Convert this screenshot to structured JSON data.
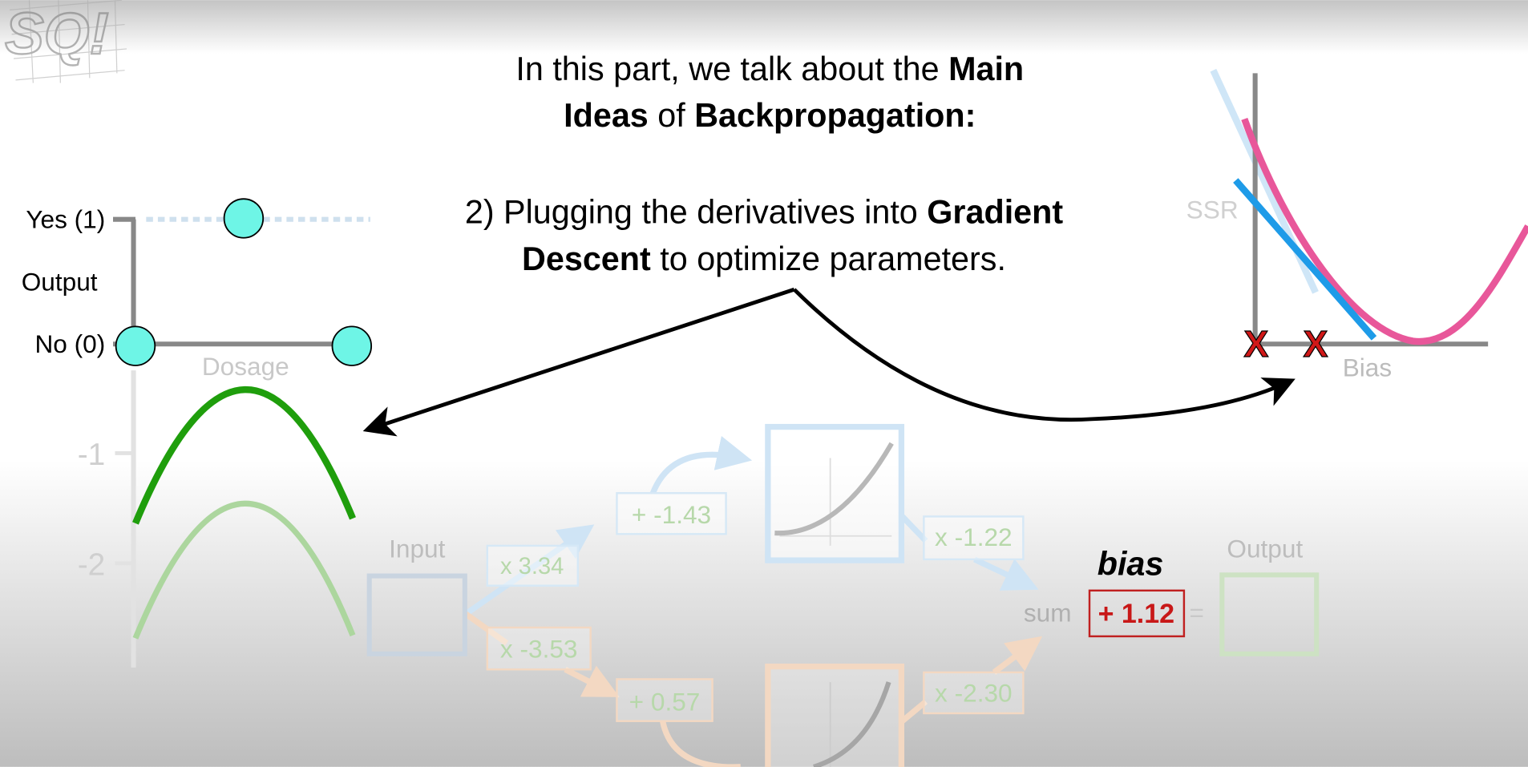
{
  "logo": {
    "text": "SQ!"
  },
  "heading": {
    "line1_a": "In this part, we talk about the ",
    "line1_b": "Main",
    "line2_a": "Ideas",
    "line2_b": " of ",
    "line2_c": "Backpropagation:",
    "line3_a": "2) Plugging the derivatives into ",
    "line3_b": "Gradient",
    "line4_a": "Descent",
    "line4_b": " to optimize parameters."
  },
  "left_chart": {
    "yes_label": "Yes (1)",
    "output_label": "Output",
    "no_label": "No (0)",
    "x_label": "Dosage",
    "tick_minus1": "-1",
    "tick_minus2": "-2"
  },
  "right_chart": {
    "y_label": "SSR",
    "x_label": "Bias",
    "marker": "X"
  },
  "network": {
    "input_label": "Input",
    "w1": "x 3.34",
    "b1": "+ -1.43",
    "w3": "x -1.22",
    "w2": "x -3.53",
    "b2": "+ 0.57",
    "w4": "x -2.30",
    "sum_label": "sum",
    "bias_label": "bias",
    "bias_value": "+ 1.12",
    "equals": "=",
    "output_label": "Output"
  },
  "colors": {
    "cyan": "#6ef5e6",
    "green": "#1f9e0c",
    "pink": "#e8579a",
    "blue": "#1e9be8",
    "red": "#d01818"
  }
}
